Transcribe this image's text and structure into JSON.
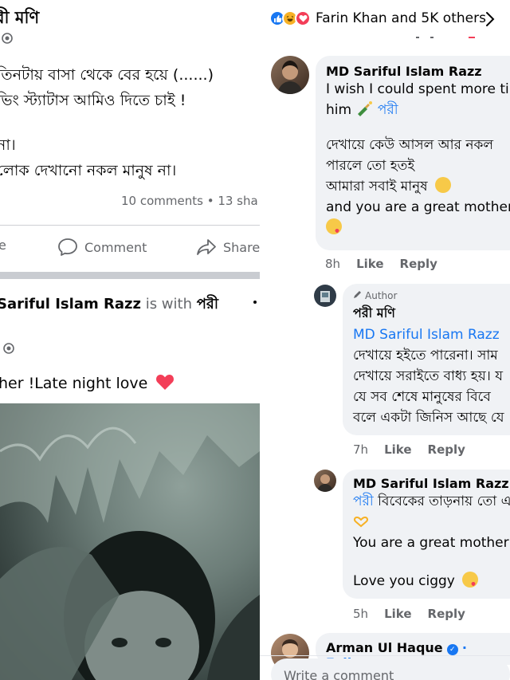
{
  "left": {
    "post1": {
      "author_name": "রী মণি",
      "text_lines": [
        "তিনটায় বাসা থেকে বের হয়ে (......)",
        "ভিং স্ট্যাটাস আমিও দিতে চাই !",
        "",
        "না।",
        "লোক দেখানো নকল মানুষ না।"
      ],
      "stats": "10 comments • 13 sha",
      "actions": {
        "like": "e",
        "comment": "Comment",
        "share": "Share"
      }
    },
    "post2": {
      "author_prefix": "",
      "author_name": "Sariful Islam Razz",
      "with_text": "is with",
      "with_name": "পরী",
      "sub_name": "।",
      "text": "her !Late night love"
    }
  },
  "right": {
    "reactions_label": "Farin Khan and 5K others",
    "comments": [
      {
        "name": "MD Sariful Islam Razz",
        "lines": [
          "I wish I could spent more tir",
          "him",
          "",
          "দেখায়ে কেউ আসল আর নকল",
          "পারলে তো হতই",
          "আমারা সবাই মানুষ",
          "and you are a great mother",
          ""
        ],
        "mention": "পরী",
        "time": "8h",
        "like": "Like",
        "reply": "Reply"
      },
      {
        "author_badge": "Author",
        "name": "পরী মণি",
        "lines": [
          "MD Sariful Islam Razz",
          "দেখায়ে হইতে পারেনা। সাম",
          "দেখায়ে সরাইতে বাধ্য হয়। য",
          "যে সব শেষে মানুষের বিবে",
          "বলে একটা জিনিস আছে যে"
        ],
        "time": "7h",
        "like": "Like",
        "reply": "Reply"
      },
      {
        "name": "MD Sariful Islam Razz",
        "mention": "পরী",
        "lines": [
          "বিবেকের তাড়নায় তো এ",
          "",
          "You are a great mother",
          "",
          "Love you ciggy"
        ],
        "time": "5h",
        "like": "Like",
        "reply": "Reply"
      },
      {
        "name": "Arman Ul Haque",
        "follow": "· Follow"
      }
    ],
    "write_placeholder": "Write a comment"
  },
  "colors": {
    "facebook_blue": "#1877f2",
    "muted_text": "#65676b",
    "bubble_bg": "#f0f2f5",
    "heart_red": "#f33e58"
  }
}
